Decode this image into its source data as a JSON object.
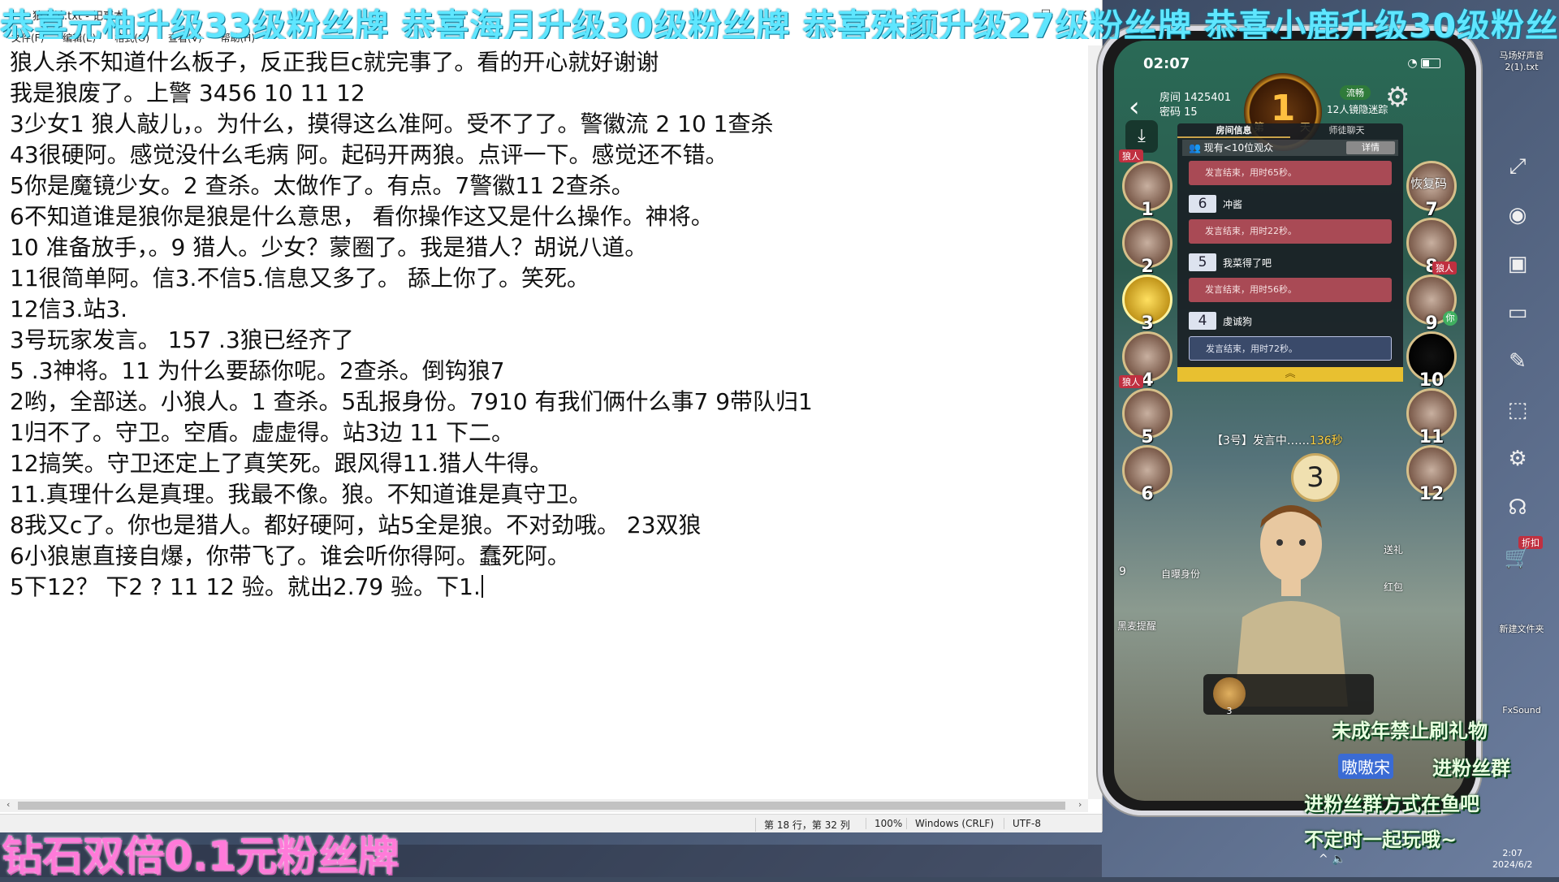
{
  "marquee": "恭喜元柚升级33级粉丝牌  恭喜海月升级30级粉丝牌  恭喜殊颜升级27级粉丝牌  恭喜小鹿升级30级粉丝牌",
  "notepad": {
    "title": "狼人杀.txt - 记事本",
    "menu": [
      "文件(F)",
      "编辑(E)",
      "格式(O)",
      "查看(V)",
      "帮助(H)"
    ],
    "lines": [
      "狼人杀不知道什么板子，反正我巨c就完事了。看的开心就好谢谢",
      "我是狼废了。上警 3456 10 11 12",
      "3少女1 狼人敲儿，。为什么，摸得这么准阿。受不了了。警徽流 2 10 1查杀",
      "43很硬阿。感觉没什么毛病 阿。起码开两狼。点评一下。感觉还不错。",
      "5你是魔镜少女。2  查杀。太做作了。有点。7警徽11  2查杀。",
      "6不知道谁是狼你是狼是什么意思，  看你操作这又是什么操作。神将。",
      "10 准备放手，。9 猎人。少女？蒙圈了。我是猎人？胡说八道。",
      "11很简单阿。信3.不信5.信息又多了。 舔上你了。笑死。",
      "12信3.站3.",
      "3号玩家发言。 157 .3狼已经齐了",
      "5 .3神将。11 为什么要舔你呢。2查杀。倒钩狼7",
      "2哟，全部送。小狼人。1 查杀。5乱报身份。7910 有我们俩什么事7 9带队归1",
      "1归不了。守卫。空盾。虚虚得。站3边 11 下二。",
      "12搞笑。守卫还定上了真笑死。跟风得11.猎人牛得。",
      "11.真理什么是真理。我最不像。狼。不知道谁是真守卫。",
      "8我又c了。你也是猎人。都好硬阿，站5全是狼。不对劲哦。 23双狼",
      "6小狼崽直接自爆，你带飞了。谁会听你得阿。蠢死阿。",
      "5下12？  下2 ? 11 12 验。就出2.79 验。下1."
    ],
    "status": {
      "position": "第 18 行，第 32 列",
      "zoom": "100%",
      "eol": "Windows (CRLF)",
      "encoding": "UTF-8"
    }
  },
  "diamond": "钻石双倍0.1元粉丝牌",
  "phone": {
    "time": "02:07",
    "room": "房间 1425401",
    "password": "密码 15",
    "day_num": "1",
    "day_pre": "第",
    "day_suf": "天",
    "network": "流畅",
    "rule": "12人镜隐迷踪",
    "tabs": [
      "房间信息",
      "师徒聊天"
    ],
    "audience": "现有<10位观众",
    "detail": "详情",
    "messages": [
      {
        "type": "msg",
        "text": "发言结束，用时65秒。"
      },
      {
        "type": "speaker",
        "num": "6",
        "name": "冲酱"
      },
      {
        "type": "msg",
        "text": "发言结束，用时22秒。"
      },
      {
        "type": "speaker",
        "num": "5",
        "name": "我菜得了吧"
      },
      {
        "type": "msg",
        "text": "发言结束，用时56秒。"
      },
      {
        "type": "speaker",
        "num": "4",
        "name": "虔诚狗"
      },
      {
        "type": "msg",
        "text": "发言结束，用时72秒。"
      }
    ],
    "wolf_tag": "狼人",
    "restore_code": "恢复码",
    "you_tag": "你",
    "seats_left": [
      "1",
      "2",
      "3",
      "4",
      "5",
      "6"
    ],
    "seats_right": [
      "7",
      "8",
      "9",
      "10",
      "11",
      "12"
    ],
    "speaking_label": "【3号】发言中……",
    "speaking_time": "136秒",
    "current_speaker": "3",
    "gift": "送礼",
    "redpack": "红包",
    "self_reveal": "自曝身份",
    "audience_count": "9",
    "mic_remind": "黑麦提醒",
    "coin_num": "3"
  },
  "right_side": {
    "file1": "马场好声音2(1).txt",
    "sale_tag": "折扣",
    "folder": "新建文件夹",
    "fxsound": "FxSound"
  },
  "overlay": {
    "line1": "未成年禁止刷礼物",
    "line2_pill": "嗷嗷宋",
    "line2": "进粉丝群",
    "line3": "进粉丝群方式在鱼吧",
    "line4": "不定时一起玩哦~"
  },
  "clock": {
    "time": "2:07",
    "date": "2024/6/2"
  },
  "colors": {
    "marquee": "#5fe6ff",
    "diamond": "#ff7ad9",
    "wolf": "#c03040",
    "speaking_time": "#ffd040"
  }
}
